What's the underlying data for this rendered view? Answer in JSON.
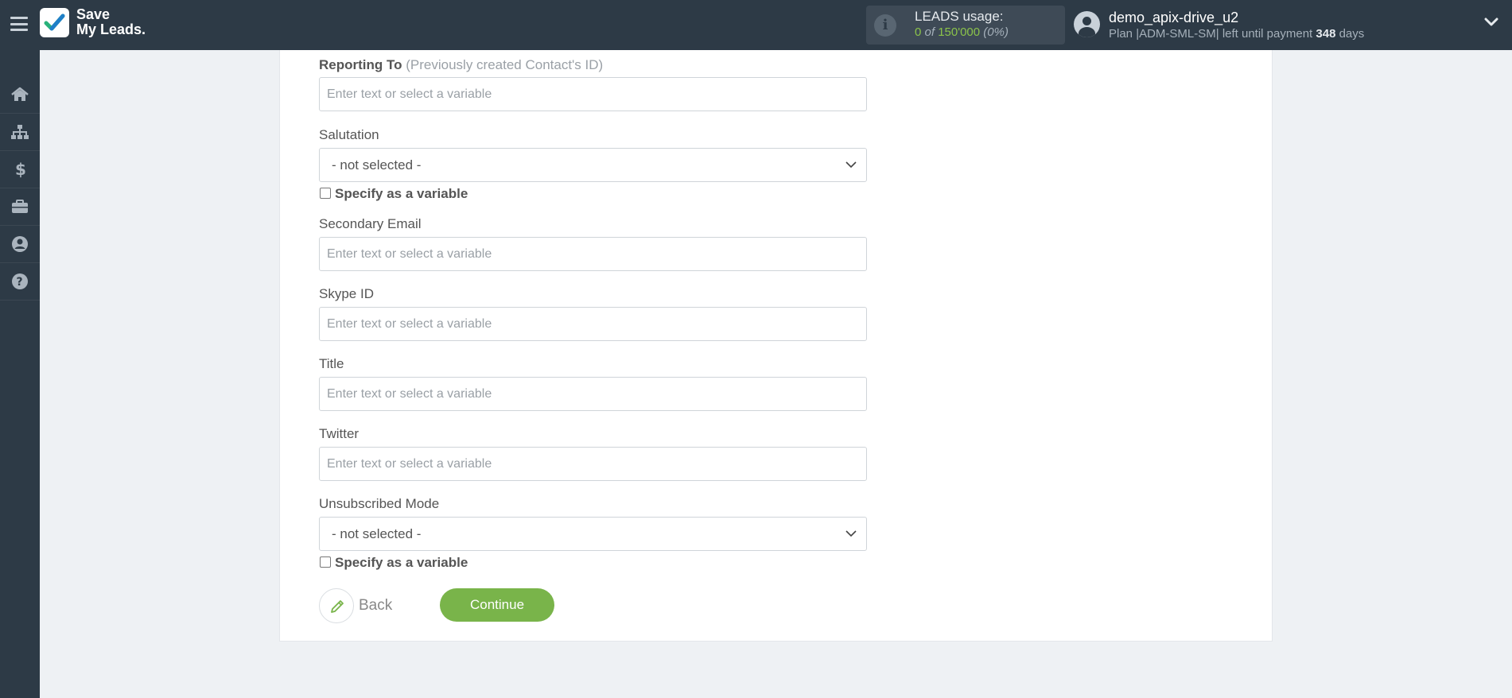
{
  "header": {
    "logo_text_line1": "Save",
    "logo_text_line2": "My Leads.",
    "leads": {
      "title": "LEADS usage:",
      "used": "0",
      "of": "of",
      "total": "150'000",
      "percent": "(0%)"
    },
    "user": {
      "name": "demo_apix-drive_u2",
      "plan_prefix": "Plan |ADM-SML-SM| left until payment",
      "days": "348",
      "days_suffix": "days"
    }
  },
  "sidebar": {
    "items": [
      {
        "icon": "home-icon"
      },
      {
        "icon": "sitemap-icon"
      },
      {
        "icon": "dollar-icon"
      },
      {
        "icon": "briefcase-icon"
      },
      {
        "icon": "user-circle-icon"
      },
      {
        "icon": "question-circle-icon"
      }
    ]
  },
  "form": {
    "reporting_to": {
      "label": "Reporting To",
      "hint": "(Previously created Contact's ID)",
      "placeholder": "Enter text or select a variable"
    },
    "salutation": {
      "label": "Salutation",
      "value": "- not selected -",
      "checkbox_label": "Specify as a variable"
    },
    "secondary_email": {
      "label": "Secondary Email",
      "placeholder": "Enter text or select a variable"
    },
    "skype_id": {
      "label": "Skype ID",
      "placeholder": "Enter text or select a variable"
    },
    "title": {
      "label": "Title",
      "placeholder": "Enter text or select a variable"
    },
    "twitter": {
      "label": "Twitter",
      "placeholder": "Enter text or select a variable"
    },
    "unsubscribed_mode": {
      "label": "Unsubscribed Mode",
      "value": "- not selected -",
      "checkbox_label": "Specify as a variable"
    },
    "back_label": "Back",
    "continue_label": "Continue"
  },
  "colors": {
    "topbar": "#2d3a46",
    "accent_green": "#79b44a",
    "usage_green": "#8bc34a"
  }
}
